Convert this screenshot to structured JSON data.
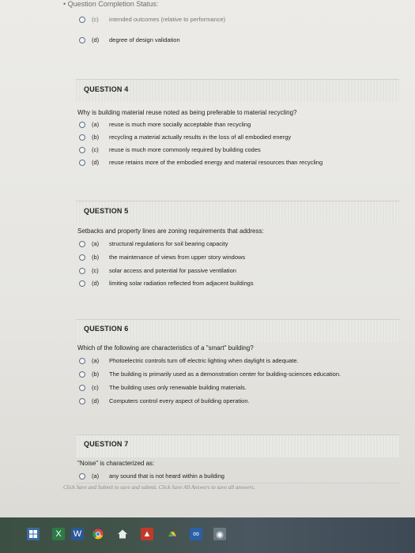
{
  "status": {
    "label": "Question Completion Status:"
  },
  "prev_question": {
    "options": [
      {
        "letter": "(c)",
        "text": "intended outcomes (relative to performance)"
      },
      {
        "letter": "(d)",
        "text": "degree of design validation"
      }
    ]
  },
  "questions": [
    {
      "title": "QUESTION 4",
      "text": "Why is building material reuse noted as being preferable to material recycling?",
      "options": [
        {
          "letter": "(a)",
          "text": "reuse is much more socially acceptable than recycling"
        },
        {
          "letter": "(b)",
          "text": "recycling a material actually results in the loss of all embodied energy"
        },
        {
          "letter": "(c)",
          "text": "reuse is much more commonly required by building codes"
        },
        {
          "letter": "(d)",
          "text": "reuse retains more of the embodied energy and material resources than recycling"
        }
      ]
    },
    {
      "title": "QUESTION 5",
      "text": "Setbacks and property lines are zoning requirements that address:",
      "options": [
        {
          "letter": "(a)",
          "text": "structural regulations for soil bearing capacity"
        },
        {
          "letter": "(b)",
          "text": "the maintenance of views from upper story windows"
        },
        {
          "letter": "(c)",
          "text": "solar access and potential for passive ventilation"
        },
        {
          "letter": "(d)",
          "text": "limiting solar radiation reflected from adjacent buildings"
        }
      ]
    },
    {
      "title": "QUESTION 6",
      "text": "Which of the following are characteristics of a \"smart\" building?",
      "options": [
        {
          "letter": "(a)",
          "text": "Photoelectric controls turn off electric lighting when daylight is adequate."
        },
        {
          "letter": "(b)",
          "text": "The building is primarily used as a demonstration center for building-sciences education."
        },
        {
          "letter": "(c)",
          "text": "The building uses only renewable building materials."
        },
        {
          "letter": "(d)",
          "text": "Computers control every aspect of building operation."
        }
      ]
    },
    {
      "title": "QUESTION 7",
      "text": "\"Noise\" is characterized as:",
      "options": [
        {
          "letter": "(a)",
          "text": "any sound that is not heard within a building"
        }
      ]
    }
  ],
  "footer": {
    "text": "Click Save and Submit to save and submit. Click Save All Answers to save all answers."
  },
  "colors": {
    "radio_border": "#5f6f86",
    "taskbar": "#42534a"
  },
  "taskbar": {
    "icons": [
      "windows-icon",
      "excel-icon",
      "word-icon",
      "chrome-icon",
      "home-icon",
      "app-icon",
      "drive-icon",
      "link-icon",
      "photos-icon"
    ]
  }
}
